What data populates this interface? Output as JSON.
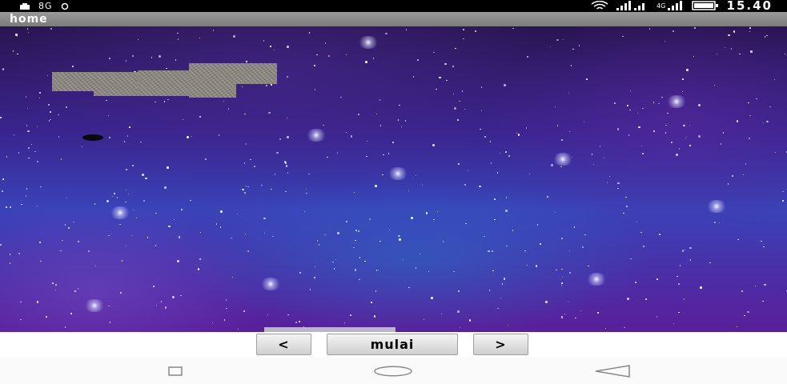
{
  "status_bar": {
    "left_text": "8G",
    "time": "15.40",
    "icons": [
      "notification-icon",
      "signal-icon",
      "wifi-icon",
      "cellular-signal-icon",
      "battery-icon"
    ]
  },
  "title_bar": {
    "title": "home"
  },
  "game": {
    "background": "starry-galaxy",
    "bricks_count": 5,
    "ball": "ball",
    "paddle": "paddle"
  },
  "controls": {
    "prev_label": "<",
    "start_label": "mulai",
    "next_label": ">"
  },
  "nav_bar": {
    "icons": [
      "recent-apps-icon",
      "home-icon",
      "back-icon"
    ]
  },
  "colors": {
    "status_bar_bg": "#000000",
    "title_bar_bg": "#8a8a8a",
    "space_dark": "#2a1552",
    "space_mid": "#3a43b8",
    "space_purple": "#5a1f9a",
    "brick": "#8d877f",
    "button_bg": "#e0e0e0"
  }
}
